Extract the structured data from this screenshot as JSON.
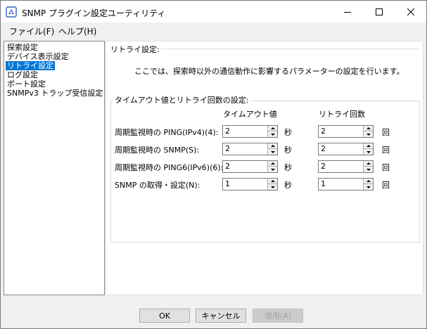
{
  "window": {
    "title": "SNMP プラグイン設定ユーティリティ"
  },
  "menu": [
    "ファイル(F)",
    "ヘルプ(H)"
  ],
  "sidebar": {
    "items": [
      {
        "label": "探索設定",
        "selected": false
      },
      {
        "label": "デバイス表示設定",
        "selected": false
      },
      {
        "label": "リトライ設定",
        "selected": true
      },
      {
        "label": "ログ設定",
        "selected": false
      },
      {
        "label": "ポート設定",
        "selected": false
      },
      {
        "label": "SNMPv3 トラップ受信設定",
        "selected": false
      }
    ]
  },
  "panel": {
    "section_title": "リトライ設定:",
    "description": "ここでは、探索時以外の通信動作に影響するパラメーターの設定を行います。",
    "group_title": "タイムアウト値とリトライ回数の設定:",
    "col_timeout": "タイムアウト値",
    "col_retry": "リトライ回数",
    "rows": [
      {
        "label": "周期監視時の PING(IPv4)(4):",
        "timeout": "2",
        "timeout_unit": "秒",
        "retry": "2",
        "retry_unit": "回"
      },
      {
        "label": "周期監視時の SNMP(S):",
        "timeout": "2",
        "timeout_unit": "秒",
        "retry": "2",
        "retry_unit": "回"
      },
      {
        "label": "周期監視時の PING6(IPv6)(6):",
        "timeout": "2",
        "timeout_unit": "秒",
        "retry": "2",
        "retry_unit": "回"
      },
      {
        "label": "SNMP の取得・設定(N):",
        "timeout": "1",
        "timeout_unit": "秒",
        "retry": "1",
        "retry_unit": "回"
      }
    ]
  },
  "buttons": {
    "ok": "OK",
    "cancel": "キャンセル",
    "apply": "適用(A)"
  },
  "colors": {
    "selection": "#0078d7",
    "window_bg": "#f0f0f0"
  }
}
